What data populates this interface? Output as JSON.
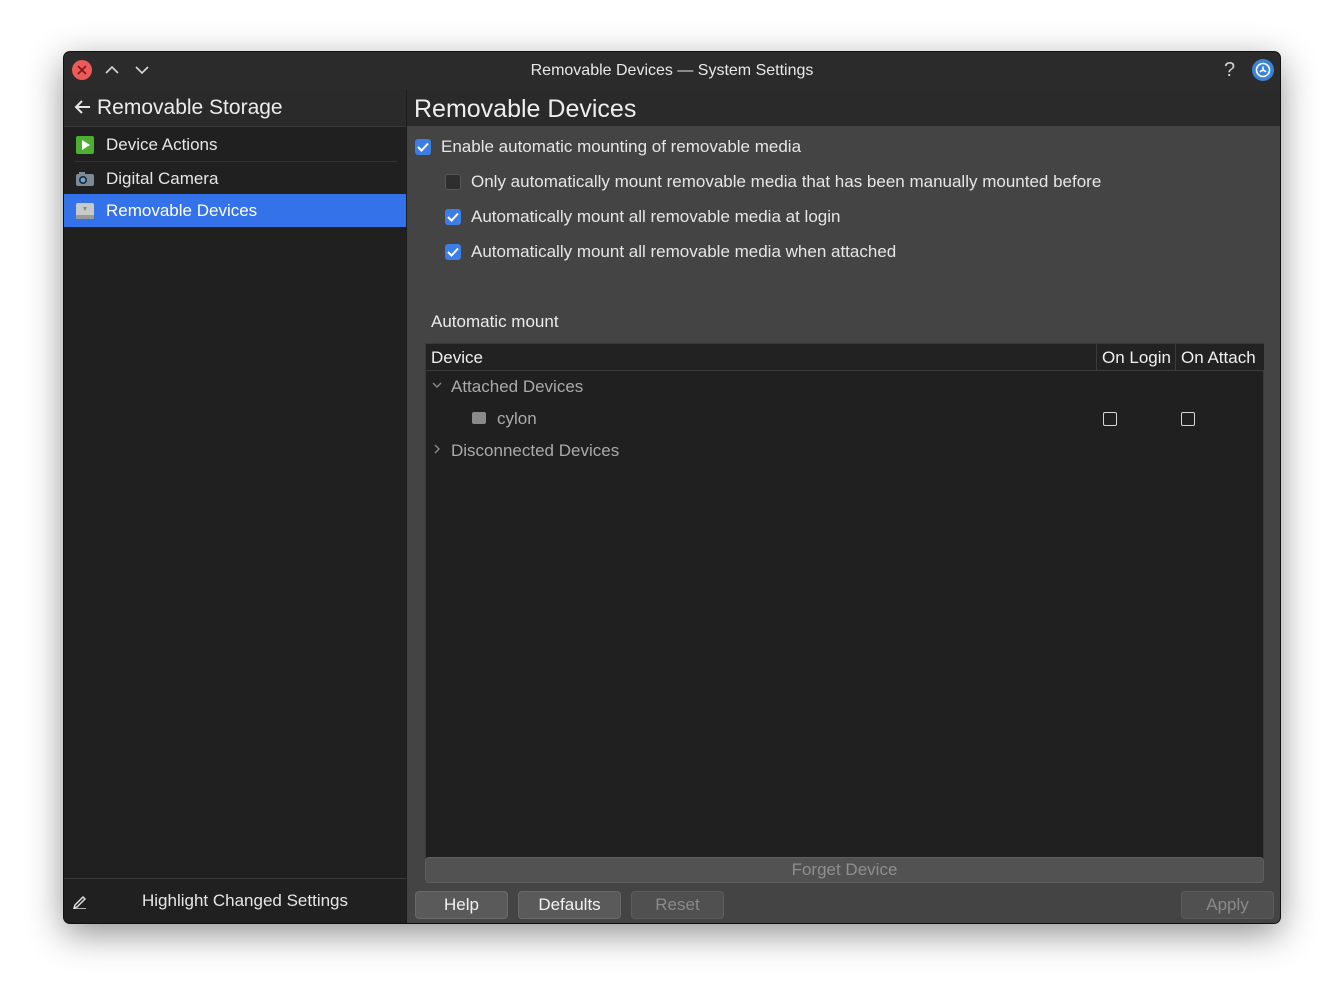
{
  "window": {
    "title": "Removable Devices — System Settings"
  },
  "sidebar": {
    "header": "Removable Storage",
    "items": [
      {
        "label": "Device Actions",
        "icon": "play-icon",
        "color": "#4caf32"
      },
      {
        "label": "Digital Camera",
        "icon": "camera-icon",
        "color": "#6aa5d8"
      },
      {
        "label": "Removable Devices",
        "icon": "drive-icon",
        "selected": true
      }
    ],
    "footer": "Highlight Changed Settings"
  },
  "main": {
    "title": "Removable Devices",
    "options": [
      {
        "label": "Enable automatic mounting of removable media",
        "checked": true
      },
      {
        "label": "Only automatically mount removable media that has been manually mounted before",
        "checked": false
      },
      {
        "label": "Automatically mount all removable media at login",
        "checked": true
      },
      {
        "label": "Automatically mount all removable media when attached",
        "checked": true
      }
    ],
    "section_label": "Automatic mount",
    "table": {
      "columns": [
        "Device",
        "On Login",
        "On Attach"
      ],
      "groups": [
        {
          "label": "Attached Devices",
          "expanded": true,
          "devices": [
            {
              "name": "cylon",
              "on_login": false,
              "on_attach": false
            }
          ]
        },
        {
          "label": "Disconnected Devices",
          "expanded": false,
          "devices": []
        }
      ]
    },
    "forget_button": "Forget Device",
    "buttons": {
      "help": "Help",
      "defaults": "Defaults",
      "reset": "Reset",
      "apply": "Apply"
    }
  },
  "colors": {
    "accent": "#3472ea",
    "close": "#ed5a5a"
  }
}
